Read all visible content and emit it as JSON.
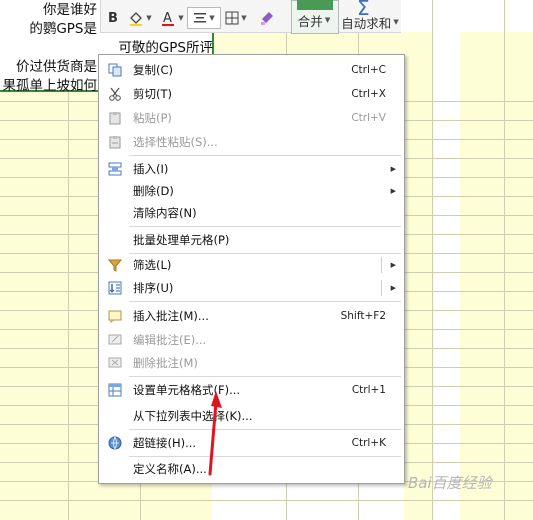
{
  "cells": {
    "lines": [
      "你是谁好",
      "的鹦GPS是",
      "可敬的GPS所评",
      "价过供货商是",
      "果孤单上坡如何"
    ]
  },
  "toolbar": {
    "merge_label": "合并",
    "autosum_label": "自动求和"
  },
  "context_menu": {
    "items": [
      {
        "label": "复制(C)",
        "shortcut": "Ctrl+C",
        "icon": "copy-icon",
        "disabled": false
      },
      {
        "label": "剪切(T)",
        "shortcut": "Ctrl+X",
        "icon": "scissors-icon",
        "disabled": false
      },
      {
        "label": "粘贴(P)",
        "shortcut": "Ctrl+V",
        "icon": "paste-icon",
        "disabled": true
      },
      {
        "label": "选择性粘贴(S)...",
        "shortcut": "",
        "icon": "paste-special-icon",
        "disabled": true
      },
      {
        "label": "插入(I)",
        "shortcut": "",
        "icon": "insert-icon",
        "disabled": false
      },
      {
        "label": "删除(D)",
        "shortcut": "",
        "icon": "",
        "disabled": false
      },
      {
        "label": "清除内容(N)",
        "shortcut": "",
        "icon": "",
        "disabled": false
      },
      {
        "label": "批量处理单元格(P)",
        "shortcut": "",
        "icon": "",
        "disabled": false
      },
      {
        "label": "筛选(L)",
        "shortcut": "",
        "icon": "filter-icon",
        "disabled": false
      },
      {
        "label": "排序(U)",
        "shortcut": "",
        "icon": "sort-icon",
        "disabled": false
      },
      {
        "label": "插入批注(M)...",
        "shortcut": "Shift+F2",
        "icon": "insert-comment-icon",
        "disabled": false
      },
      {
        "label": "编辑批注(E)...",
        "shortcut": "",
        "icon": "edit-comment-icon",
        "disabled": true
      },
      {
        "label": "删除批注(M)",
        "shortcut": "",
        "icon": "delete-comment-icon",
        "disabled": true
      },
      {
        "label": "设置单元格格式(F)...",
        "shortcut": "Ctrl+1",
        "icon": "format-cells-icon",
        "disabled": false
      },
      {
        "label": "从下拉列表中选择(K)...",
        "shortcut": "",
        "icon": "",
        "disabled": false
      },
      {
        "label": "超链接(H)...",
        "shortcut": "Ctrl+K",
        "icon": "hyperlink-icon",
        "disabled": false
      },
      {
        "label": "定义名称(A)...",
        "shortcut": "",
        "icon": "",
        "disabled": false
      }
    ]
  },
  "watermark": "Bai百度经验",
  "colors": {
    "cell_bg": "#fdfdd6",
    "selection_border": "#2e8b3a",
    "annotation_arrow": "#e0141e"
  }
}
